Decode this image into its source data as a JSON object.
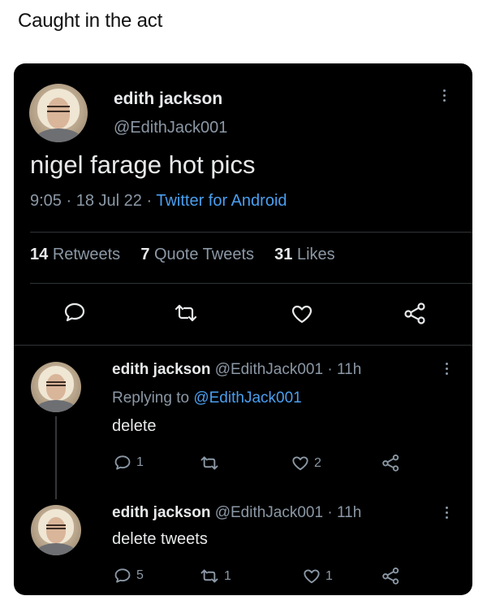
{
  "caption": "Caught in the act",
  "main_tweet": {
    "display_name": "edith jackson",
    "handle": "@EdithJack001",
    "text": "nigel farage hot pics",
    "time": "9:05",
    "date": "18 Jul 22",
    "source": "Twitter for Android",
    "separator": "·",
    "retweets_count": "14",
    "retweets_label": "Retweets",
    "quotes_count": "7",
    "quotes_label": "Quote Tweets",
    "likes_count": "31",
    "likes_label": "Likes"
  },
  "replies": [
    {
      "display_name": "edith jackson",
      "handle": "@EdithJack001",
      "age": "11h",
      "replying_prefix": "Replying to",
      "replying_handle": "@EdithJack001",
      "text": "delete",
      "reply_count": "1",
      "retweet_count": "",
      "like_count": "2"
    },
    {
      "display_name": "edith jackson",
      "handle": "@EdithJack001",
      "age": "11h",
      "text": "delete tweets",
      "reply_count": "5",
      "retweet_count": "1",
      "like_count": "1"
    }
  ],
  "icons": [
    "reply-icon",
    "retweet-icon",
    "like-icon",
    "share-icon",
    "more-icon",
    "avatar"
  ],
  "colors": {
    "background": "#000000",
    "text": "#e7e9ea",
    "muted": "#8b98a5",
    "link": "#4a9ff0"
  }
}
